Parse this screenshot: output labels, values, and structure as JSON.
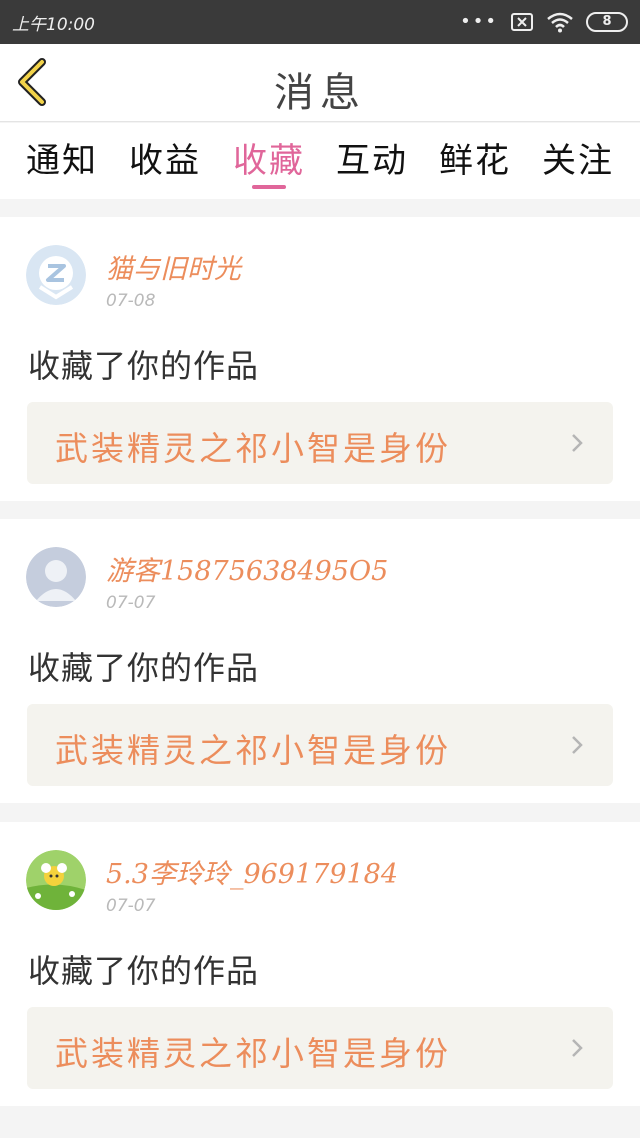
{
  "status": {
    "time": "上午10:00",
    "dots": "•••",
    "battery": "8"
  },
  "nav": {
    "title": "消息"
  },
  "tabs": [
    {
      "label": "通知"
    },
    {
      "label": "收益"
    },
    {
      "label": "收藏"
    },
    {
      "label": "互动"
    },
    {
      "label": "鲜花"
    },
    {
      "label": "关注"
    }
  ],
  "active_tab": "收藏",
  "messages": [
    {
      "username": "猫与旧时光",
      "date": "07-08",
      "action": "收藏了你的作品",
      "work_title": "武装精灵之祁小智是身份"
    },
    {
      "username": "游客15875638495O5",
      "date": "07-07",
      "action": "收藏了你的作品",
      "work_title": "武装精灵之祁小智是身份"
    },
    {
      "username": "5.3李玲玲_969179184",
      "date": "07-07",
      "action": "收藏了你的作品",
      "work_title": "武装精灵之祁小智是身份"
    }
  ],
  "colors": {
    "accent": "#e0669a",
    "username": "#ec8d5c",
    "status_bar": "#3a3a3a"
  }
}
